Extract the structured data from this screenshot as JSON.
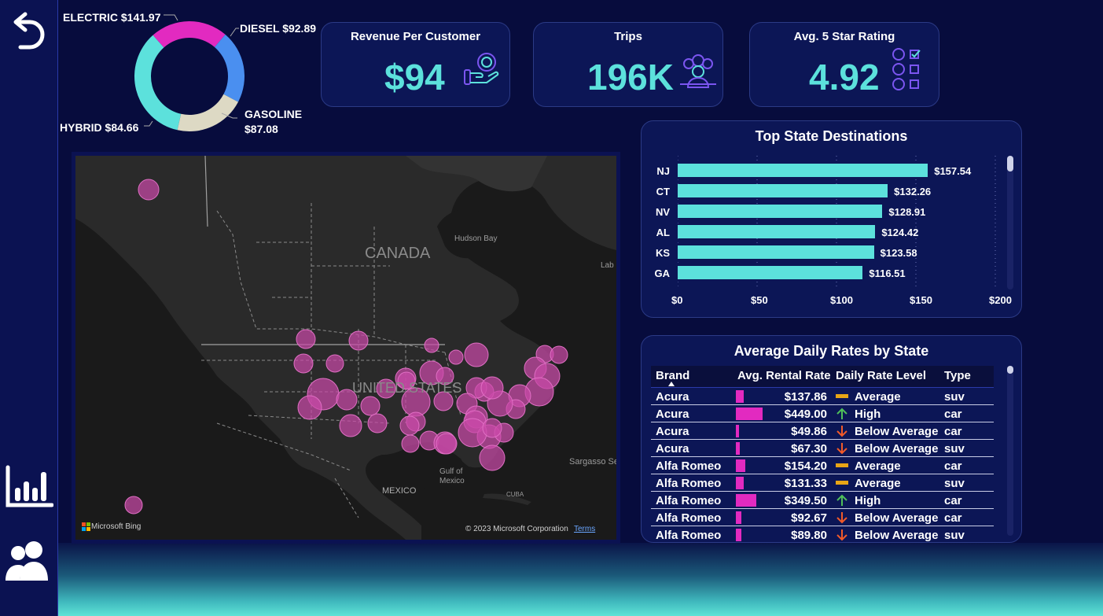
{
  "nav": {
    "back_label": "Back",
    "report_label": "Report",
    "users_label": "Users"
  },
  "kpis": [
    {
      "title": "Revenue Per Customer",
      "value": "$94",
      "icon": "hand-coin-icon"
    },
    {
      "title": "Trips",
      "value": "196K",
      "icon": "group-people-icon"
    },
    {
      "title": "Avg. 5 Star Rating",
      "value": "4.92",
      "icon": "rating-checklist-icon"
    }
  ],
  "donut": {
    "labels": {
      "electric": "ELECTRIC $141.97",
      "diesel": "DIESEL $92.89",
      "gasoline_line1": "GASOLINE",
      "gasoline_line2": "$87.08",
      "hybrid": "HYBRID $84.66"
    }
  },
  "map": {
    "country_canada": "CANADA",
    "country_us": "UNITED STATES",
    "country_mexico": "MEXICO",
    "hudson_bay": "Hudson Bay",
    "gulf_line1": "Gulf of",
    "gulf_line2": "Mexico",
    "sargasso": "Sargasso Se",
    "cuba": "CUBA",
    "labrador": "Lab",
    "bing": "Microsoft Bing",
    "copyright": "© 2023 Microsoft Corporation",
    "terms": "Terms"
  },
  "top_states": {
    "title": "Top State Destinations",
    "axis_labels": [
      "$0",
      "$50",
      "$100",
      "$150",
      "$200"
    ]
  },
  "rates_table": {
    "title": "Average Daily Rates by State",
    "headers": {
      "brand": "Brand",
      "rate": "Avg. Rental Rate",
      "level": "Daily Rate Level",
      "type": "Type"
    },
    "rows": [
      {
        "brand": "Acura",
        "rate": "$137.86",
        "rate_value": 137.86,
        "level": "Average",
        "level_icon": "dash-icon",
        "type": "suv"
      },
      {
        "brand": "Acura",
        "rate": "$449.00",
        "rate_value": 449.0,
        "level": "High",
        "level_icon": "arrow-up-icon",
        "type": "car"
      },
      {
        "brand": "Acura",
        "rate": "$49.86",
        "rate_value": 49.86,
        "level": "Below Average",
        "level_icon": "arrow-down-icon",
        "type": "car"
      },
      {
        "brand": "Acura",
        "rate": "$67.30",
        "rate_value": 67.3,
        "level": "Below Average",
        "level_icon": "arrow-down-icon",
        "type": "suv"
      },
      {
        "brand": "Alfa Romeo",
        "rate": "$154.20",
        "rate_value": 154.2,
        "level": "Average",
        "level_icon": "dash-icon",
        "type": "car"
      },
      {
        "brand": "Alfa Romeo",
        "rate": "$131.33",
        "rate_value": 131.33,
        "level": "Average",
        "level_icon": "dash-icon",
        "type": "suv"
      },
      {
        "brand": "Alfa Romeo",
        "rate": "$349.50",
        "rate_value": 349.5,
        "level": "High",
        "level_icon": "arrow-up-icon",
        "type": "car"
      },
      {
        "brand": "Alfa Romeo",
        "rate": "$92.67",
        "rate_value": 92.67,
        "level": "Below Average",
        "level_icon": "arrow-down-icon",
        "type": "car"
      },
      {
        "brand": "Alfa Romeo",
        "rate": "$89.80",
        "rate_value": 89.8,
        "level": "Below Average",
        "level_icon": "arrow-down-icon",
        "type": "suv"
      }
    ]
  },
  "colors": {
    "accent_teal": "#5ce1dc",
    "magenta": "#e22ac0",
    "blue": "#4a8ff0",
    "beige": "#ddd9c4",
    "level_average": "#e8a516",
    "level_high": "#4fbf5a",
    "level_below": "#f15a29"
  },
  "chart_data": [
    {
      "type": "pie",
      "categories": [
        "ELECTRIC",
        "DIESEL",
        "GASOLINE",
        "HYBRID"
      ],
      "values": [
        141.97,
        92.89,
        87.08,
        84.66
      ],
      "colors": [
        "#5ce1dc",
        "#e22ac0",
        "#4a8ff0",
        "#ddd9c4"
      ],
      "donut": true
    },
    {
      "type": "bar",
      "orientation": "horizontal",
      "title": "Top State Destinations",
      "categories": [
        "NJ",
        "CT",
        "NV",
        "AL",
        "KS",
        "GA"
      ],
      "values": [
        157.54,
        132.26,
        128.91,
        124.42,
        123.58,
        116.51
      ],
      "value_labels": [
        "$157.54",
        "$132.26",
        "$128.91",
        "$124.42",
        "$123.58",
        "$116.51"
      ],
      "xlim": [
        0,
        200
      ]
    }
  ]
}
